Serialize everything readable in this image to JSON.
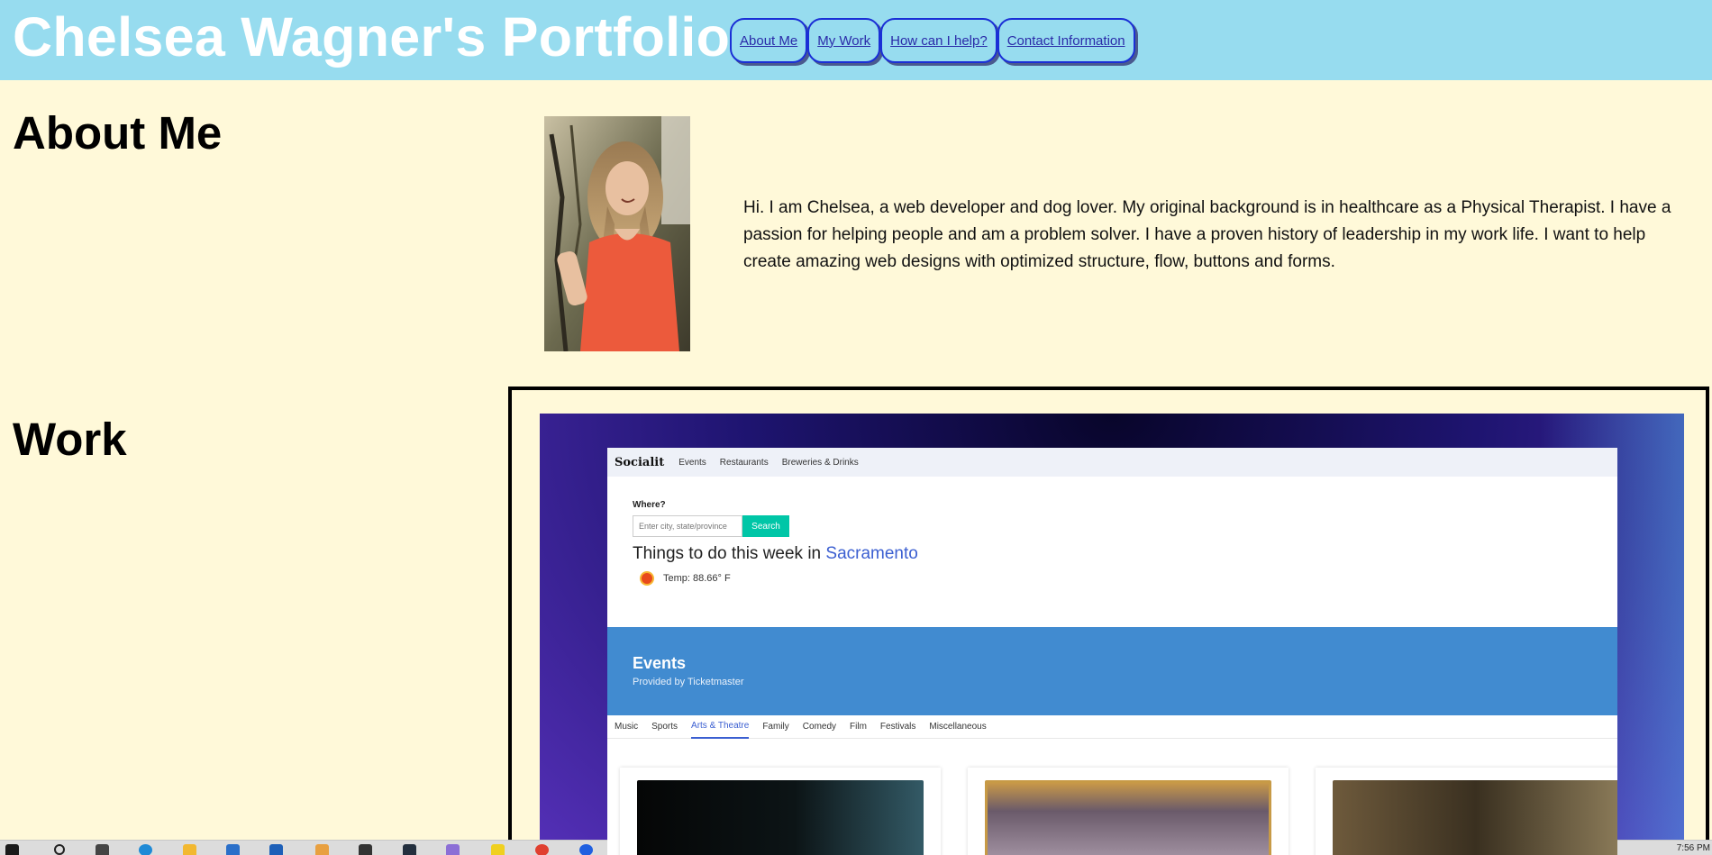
{
  "header": {
    "title": "Chelsea Wagner's Portfolio",
    "nav": [
      "About Me",
      "My Work",
      "How can I help?",
      "Contact Information"
    ]
  },
  "about": {
    "heading": "About Me",
    "text": "Hi. I am Chelsea, a web developer and dog lover. My original background is in healthcare as a Physical Therapist. I have a passion for helping people and am a problem solver. I have a proven history of leadership in my work life. I want to help create amazing web designs with optimized structure, flow, buttons and forms."
  },
  "work": {
    "heading": "Work",
    "screenshot": {
      "logo": "Socialit",
      "nav": [
        "Events",
        "Restaurants",
        "Breweries & Drinks"
      ],
      "where_label": "Where?",
      "search_placeholder": "Enter city, state/province",
      "search_button": "Search",
      "heading_prefix": "Things to do this week in",
      "city": "Sacramento",
      "temp": "Temp: 88.66° F",
      "events_title": "Events",
      "events_subtitle": "Provided by Ticketmaster",
      "tabs": [
        "Music",
        "Sports",
        "Arts & Theatre",
        "Family",
        "Comedy",
        "Film",
        "Festivals",
        "Miscellaneous"
      ],
      "active_tab": "Arts & Theatre"
    }
  },
  "taskbar": {
    "clock": "7:56 PM"
  },
  "colors": {
    "header_bg": "#97dcef",
    "page_bg": "#fff9d9",
    "nav_border": "#1a2fd6",
    "accent_blue": "#3b5fd1",
    "search_green": "#00c6a7",
    "events_banner": "#418bd0"
  }
}
